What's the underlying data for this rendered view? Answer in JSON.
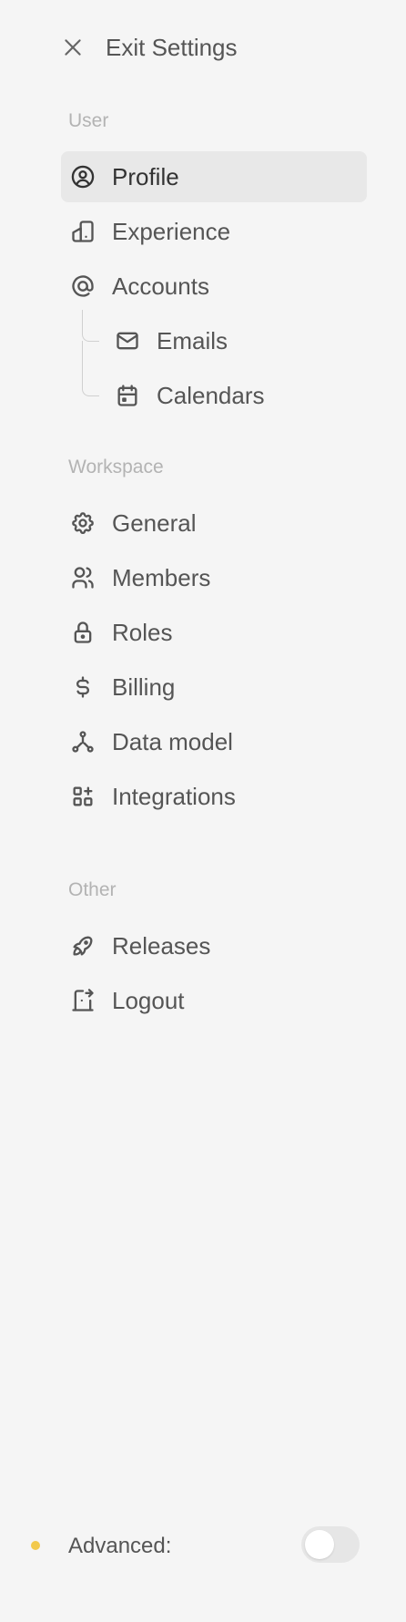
{
  "exit": {
    "label": "Exit Settings",
    "icon": "close-icon"
  },
  "sections": {
    "user": {
      "title": "User",
      "items": [
        {
          "label": "Profile",
          "icon": "user-circle-icon",
          "active": true
        },
        {
          "label": "Experience",
          "icon": "color-swatch-icon"
        },
        {
          "label": "Accounts",
          "icon": "at-icon"
        },
        {
          "label": "Emails",
          "icon": "mail-icon",
          "sub": true
        },
        {
          "label": "Calendars",
          "icon": "calendar-icon",
          "sub": true
        }
      ]
    },
    "workspace": {
      "title": "Workspace",
      "items": [
        {
          "label": "General",
          "icon": "gear-icon"
        },
        {
          "label": "Members",
          "icon": "users-icon"
        },
        {
          "label": "Roles",
          "icon": "lock-icon"
        },
        {
          "label": "Billing",
          "icon": "dollar-icon"
        },
        {
          "label": "Data model",
          "icon": "hierarchy-icon"
        },
        {
          "label": "Integrations",
          "icon": "apps-icon"
        }
      ]
    },
    "other": {
      "title": "Other",
      "items": [
        {
          "label": "Releases",
          "icon": "rocket-icon"
        },
        {
          "label": "Logout",
          "icon": "logout-icon"
        }
      ]
    }
  },
  "advanced": {
    "label": "Advanced:",
    "enabled": false,
    "dot_color": "#f2c94c"
  },
  "colors": {
    "text": "#555555",
    "section": "#b3b3b3",
    "active_bg": "#e8e8e8",
    "background": "#f5f5f5"
  }
}
